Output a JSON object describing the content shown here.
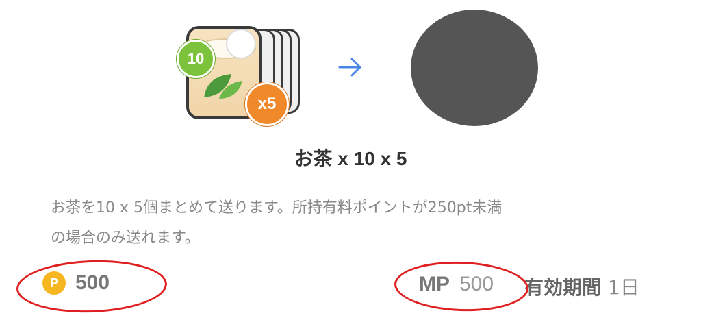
{
  "gift": {
    "badge_count": "10",
    "badge_multiplier": "x5",
    "title": "お茶 x 10 x 5",
    "description_line1": "お茶を10 x 5個まとめて送ります。所持有料ポイントが250pt未満",
    "description_line2": "の場合のみ送れます。",
    "icon": "tea-cup-stack-icon"
  },
  "arrow": {
    "icon": "arrow-right-icon",
    "color": "#4a86e8"
  },
  "recipient": {
    "icon": "avatar",
    "color": "#555555"
  },
  "price": {
    "coin_symbol": "P",
    "value": "500",
    "coin_color": "#f5b61f"
  },
  "mp": {
    "label": "MP",
    "value": "500"
  },
  "validity": {
    "label": "有効期間",
    "value": "1日"
  },
  "annotation_color": "#e02020"
}
